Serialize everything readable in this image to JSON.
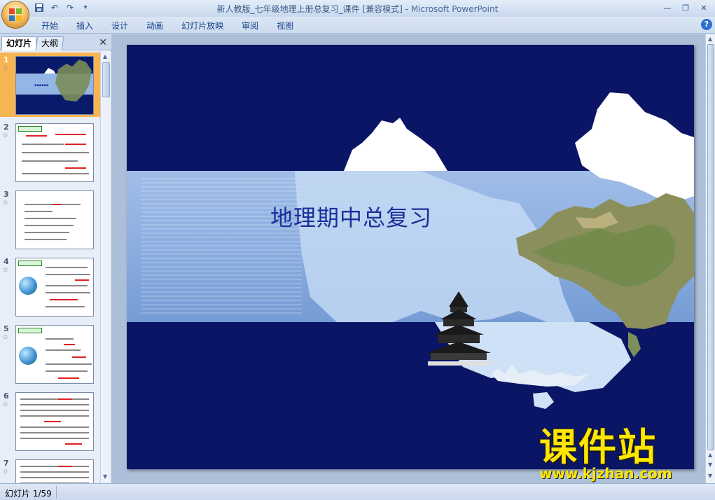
{
  "window": {
    "title": "新人教版_七年级地理上册总复习_课件 [兼容模式]",
    "separator": " - ",
    "app_name": "Microsoft PowerPoint",
    "controls": [
      "minimize-icon",
      "maximize-icon",
      "close-icon"
    ]
  },
  "quick_access": {
    "icons": [
      "save-icon",
      "undo-icon",
      "redo-icon",
      "customize-icon"
    ]
  },
  "ribbon": {
    "tabs": [
      "开始",
      "插入",
      "设计",
      "动画",
      "幻灯片放映",
      "审阅",
      "视图"
    ],
    "help_label": "?"
  },
  "left_panel": {
    "tabs": [
      "幻灯片",
      "大纲"
    ],
    "close_label": "✕",
    "thumbnails": [
      {
        "number": "1",
        "selected": true
      },
      {
        "number": "2",
        "selected": false
      },
      {
        "number": "3",
        "selected": false
      },
      {
        "number": "4",
        "selected": false
      },
      {
        "number": "5",
        "selected": false
      },
      {
        "number": "6",
        "selected": false
      },
      {
        "number": "7",
        "selected": false
      }
    ]
  },
  "slide": {
    "title": "地理期中总复习",
    "background_color": "#0b1565",
    "band_color": "#93b6e6"
  },
  "watermark": {
    "name": "课件站",
    "url": "www.kjzhan.com",
    "color": "#ffe600"
  },
  "status": {
    "slide_position": "幻灯片 1/59"
  }
}
